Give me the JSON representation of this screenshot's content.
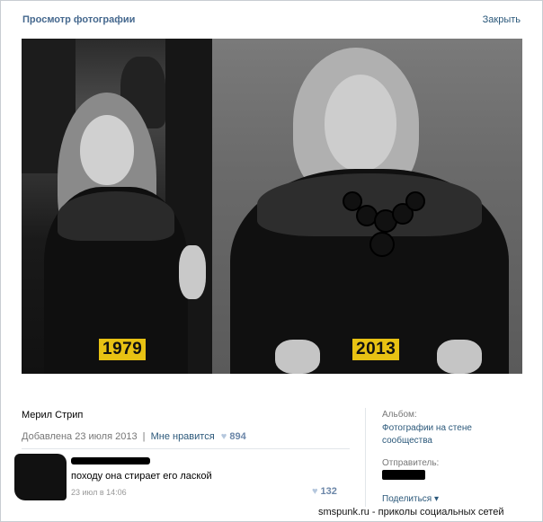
{
  "header": {
    "title": "Просмотр фотографии",
    "close_label": "Закрыть"
  },
  "photo": {
    "left_year": "1979",
    "right_year": "2013",
    "year_badge_color": "#e8c213"
  },
  "caption": {
    "name": "Мерил Стрип"
  },
  "meta": {
    "added": "Добавлена 23 июля 2013",
    "separator": "|",
    "like_label": "Мне нравится",
    "likes_count": "894"
  },
  "comment": {
    "text": "походу она стирает его лаской",
    "date": "23 июл в 14:06",
    "likes_count": "132"
  },
  "sidebar": {
    "album_label": "Альбом:",
    "album_value": "Фотографии на стене сообщества",
    "sender_label": "Отправитель:",
    "share_label": "Поделиться ▾"
  },
  "watermark": "smspunk.ru - приколы социальных сетей",
  "colors": {
    "link": "#2b587a",
    "header": "#45688e",
    "heart": "#b5c7dd"
  }
}
